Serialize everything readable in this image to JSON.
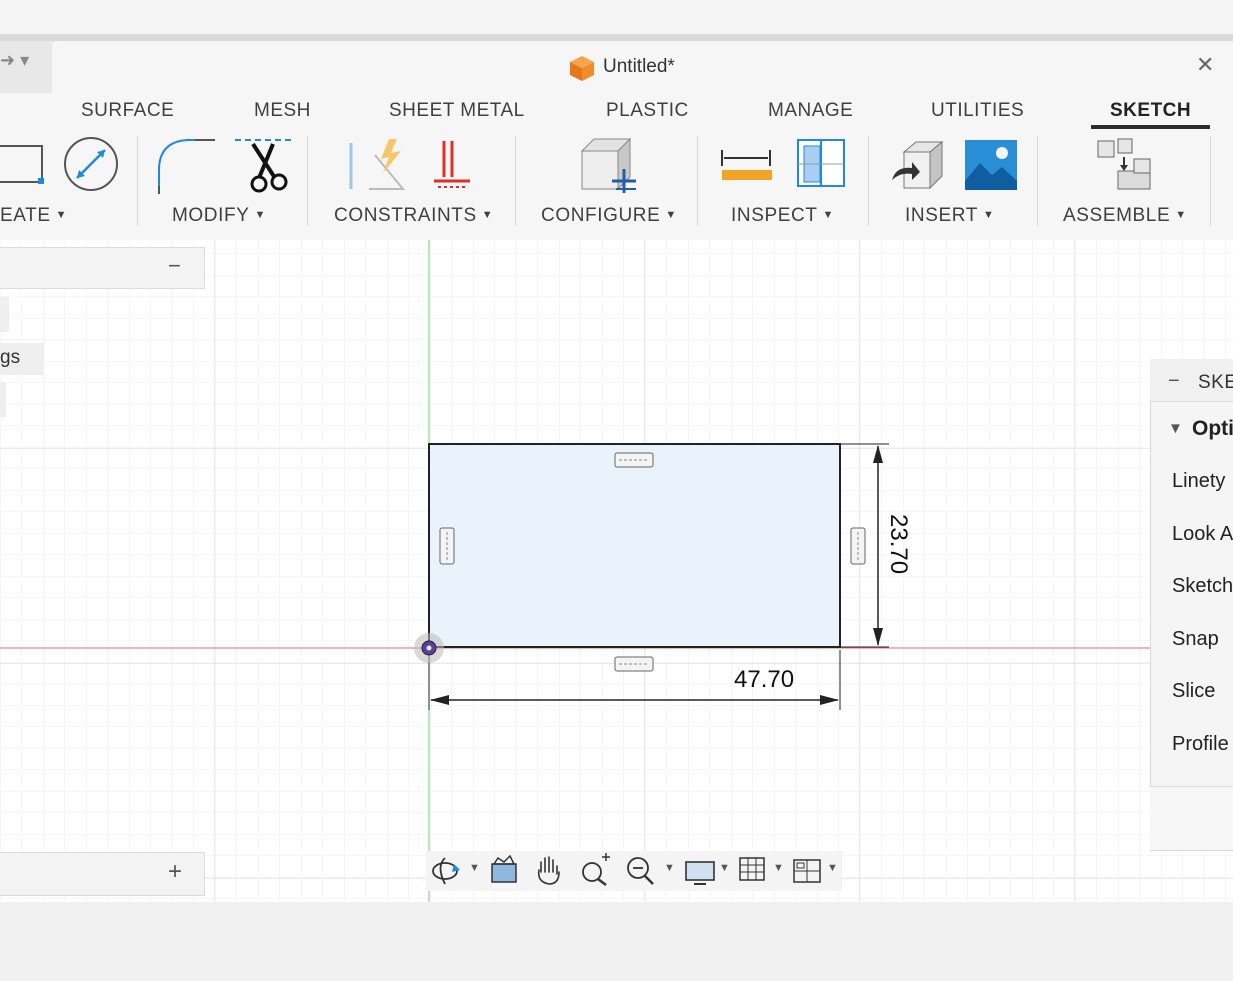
{
  "window": {
    "doc_title": "Untitled*",
    "close_label": "✕"
  },
  "ribbon": {
    "tabs": [
      {
        "label": "SURFACE"
      },
      {
        "label": "MESH"
      },
      {
        "label": "SHEET METAL"
      },
      {
        "label": "PLASTIC"
      },
      {
        "label": "MANAGE"
      },
      {
        "label": "UTILITIES"
      },
      {
        "label": "SKETCH",
        "active": true
      }
    ],
    "groups": {
      "create": "EATE",
      "modify": "MODIFY",
      "constraints": "CONSTRAINTS",
      "configure": "CONFIGURE",
      "inspect": "INSPECT",
      "insert": "INSERT",
      "assemble": "ASSEMBLE"
    }
  },
  "browser": {
    "collapse_label": "−",
    "partial_item": "gs",
    "comments_add_label": "+"
  },
  "sketch": {
    "width_dimension": "47.70",
    "height_dimension": "23.70"
  },
  "sketch_palette": {
    "header": "SKE",
    "section": "Opti",
    "rows": [
      "Linety",
      "Look A",
      "Sketch",
      "Snap",
      "Slice",
      "Profile"
    ]
  },
  "colors": {
    "accent_active_tab": "#2c2c2c",
    "x_axis": "#e46a6a",
    "y_axis": "#6fd36f",
    "profile_fill": "#eaf3fb",
    "icon_blue": "#1e88e5",
    "icon_orange": "#f08a24"
  }
}
